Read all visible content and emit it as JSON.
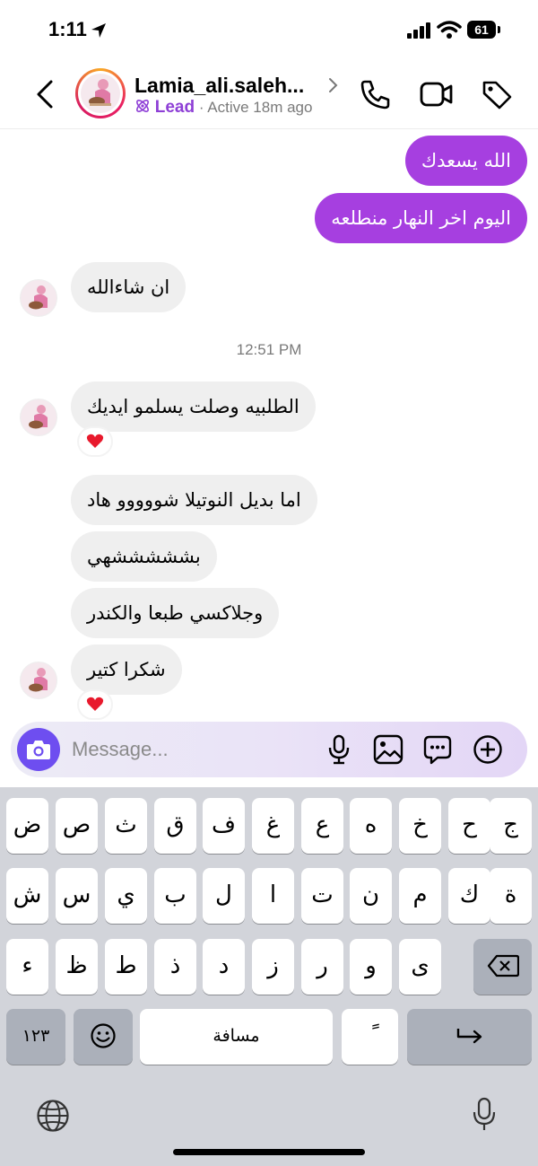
{
  "status_bar": {
    "time": "1:11",
    "battery": "61"
  },
  "header": {
    "name": "Lamia_ali.saleh...",
    "label": "Lead",
    "active": "Active 18m ago"
  },
  "messages": {
    "out_1": "الله يسعدك",
    "out_2": "اليوم اخر النهار منطلعه",
    "in_1": "ان شاءالله",
    "timestamp": "12:51 PM",
    "in_2": "الطلبيه وصلت يسلمو ايديك",
    "in_3": "اما بديل النوتيلا شووووو هاد",
    "in_4": "بشششششهي",
    "in_5": "وجلاكسي طبعا والكندر",
    "in_6": "شكرا كتير",
    "reaction": "❤️"
  },
  "composer": {
    "placeholder": "Message..."
  },
  "keyboard": {
    "row1": [
      "ض",
      "ص",
      "ث",
      "ق",
      "ف",
      "غ",
      "ع",
      "ه",
      "خ",
      "ح",
      "ج"
    ],
    "row2": [
      "ش",
      "س",
      "ي",
      "ب",
      "ل",
      "ا",
      "ت",
      "ن",
      "م",
      "ك",
      "ة"
    ],
    "row3": [
      "ء",
      "ظ",
      "ط",
      "ذ",
      "د",
      "ز",
      "ر",
      "و",
      "ى"
    ],
    "numbers_key": "١٢٣",
    "space_key": "مسافة",
    "diacritic_key": "ً"
  },
  "colors": {
    "outgoing_bubble": "#a63fe0",
    "incoming_bubble": "#efefef",
    "camera_button": "#6e4ef0",
    "lead_label": "#8e3fd6"
  }
}
